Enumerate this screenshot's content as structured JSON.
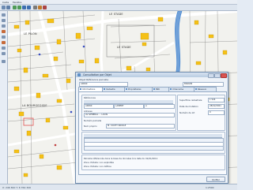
{
  "menubar": {
    "items": [
      "Carte",
      "Fenêtre"
    ]
  },
  "map": {
    "labels": {
      "le_stade_top": "LE STADE",
      "le_stade_main": "LE STADE",
      "le_pilon": "LE PILON",
      "la_bourgeoisie": "LA BOURGEOISIE",
      "la_bourgeoisie_2": "LA BOURGEOISIE"
    }
  },
  "dialog": {
    "title": "Consultation par Objet",
    "subtitle": "Objet Référence parcelle",
    "section_left": "Références",
    "section_right": "Adresse",
    "field_ref": "A0060",
    "field_commune": "BIGNAN",
    "field_lieu": "LAMERT",
    "field_section": "A",
    "field_address": "AV GENERAL ... LOUIS",
    "field_owner": "M. COUTY NICOLE",
    "label_parcel_no": "Numéro parcelle",
    "label_owner": "Nom proprio",
    "label_surface": "Superficie cadastrale",
    "label_date": "Date de mutation",
    "label_lot": "Numéro de lot",
    "value_surface": "1 524",
    "value_date": "28/02/2001",
    "value_lot": "0",
    "info_line_1": "Parcelle référencée dans la base de données à la date du 01/01/2011",
    "info_line_2": "Zone d'étude: non exploitée",
    "status_text": "Zone d'étude: non définie",
    "close_button": "Quitter"
  },
  "tabs": [
    "Informations",
    "Cadastre",
    "Propriétaires",
    "Bâti",
    "Urbanisme",
    "Réseaux"
  ],
  "status": {
    "coords": "X: 246 810  Y: 6 764 320",
    "scale": "1:2500"
  },
  "colors": {
    "building": "#f5c116",
    "water": "#3a7fd0",
    "parcel_line": "#6e6e6e",
    "road": "#ffffff",
    "selected": "#e05050",
    "dialog_accent": "#5e8fc6"
  }
}
